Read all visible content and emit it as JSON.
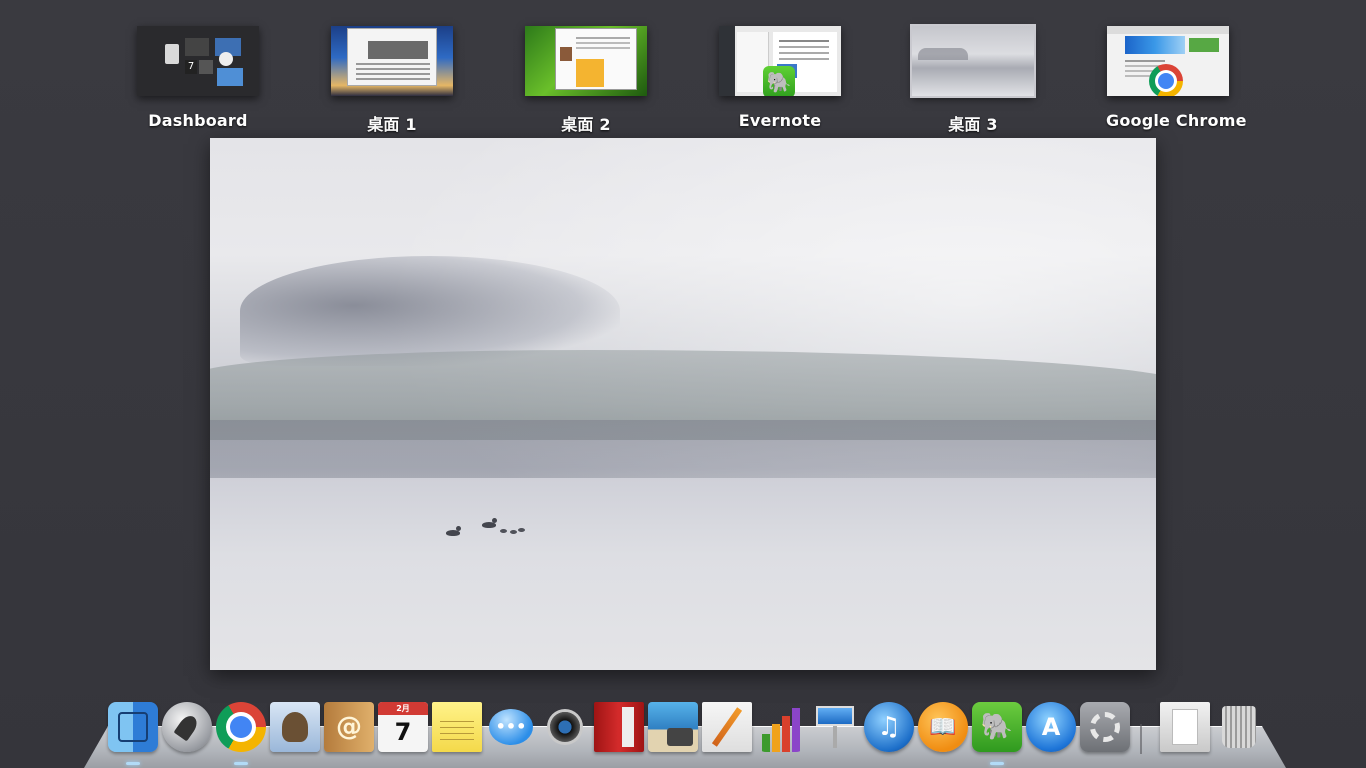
{
  "mission_control": {
    "spaces": [
      {
        "id": "dashboard",
        "label": "Dashboard"
      },
      {
        "id": "desktop1",
        "label": "桌面 1"
      },
      {
        "id": "desktop2",
        "label": "桌面 2"
      },
      {
        "id": "evernote",
        "label": "Evernote"
      },
      {
        "id": "desktop3",
        "label": "桌面 3",
        "active": true
      },
      {
        "id": "chrome",
        "label": "Google Chrome"
      }
    ],
    "dashboard_thumb": {
      "calendar_day": "7"
    },
    "evernote_thumb": {
      "badge_icon": "evernote-elephant-icon"
    },
    "chrome_thumb": {
      "badge_icon": "chrome-icon"
    }
  },
  "dock": {
    "items": [
      {
        "name": "Finder",
        "icon": "finder-icon"
      },
      {
        "name": "Launchpad",
        "icon": "rocket-icon"
      },
      {
        "name": "Google Chrome",
        "icon": "chrome-icon"
      },
      {
        "name": "Mail",
        "icon": "mail-eagle-icon"
      },
      {
        "name": "Contacts",
        "icon": "contacts-icon",
        "glyph": "@"
      },
      {
        "name": "Calendar",
        "icon": "calendar-icon",
        "month": "2月",
        "day": "7"
      },
      {
        "name": "Notes",
        "icon": "notes-icon"
      },
      {
        "name": "Messages",
        "icon": "messages-icon",
        "glyph": "•••"
      },
      {
        "name": "FaceTime",
        "icon": "facetime-icon"
      },
      {
        "name": "Photo Booth",
        "icon": "photo-booth-icon"
      },
      {
        "name": "iPhoto",
        "icon": "iphoto-icon"
      },
      {
        "name": "Pages",
        "icon": "pages-icon"
      },
      {
        "name": "Numbers",
        "icon": "numbers-icon"
      },
      {
        "name": "Keynote",
        "icon": "keynote-icon"
      },
      {
        "name": "iTunes",
        "icon": "itunes-icon",
        "glyph": "♫"
      },
      {
        "name": "iBooks",
        "icon": "ibooks-icon",
        "glyph": "📖"
      },
      {
        "name": "Evernote",
        "icon": "evernote-icon",
        "glyph": "🐘"
      },
      {
        "name": "App Store",
        "icon": "app-store-icon",
        "glyph": "A"
      },
      {
        "name": "System Preferences",
        "icon": "gear-icon"
      },
      {
        "name": "Documents",
        "icon": "documents-stack-icon"
      },
      {
        "name": "Trash",
        "icon": "trash-icon"
      }
    ]
  },
  "colors": {
    "background": "#38383e",
    "running_indicator": "#9ed4ff"
  }
}
